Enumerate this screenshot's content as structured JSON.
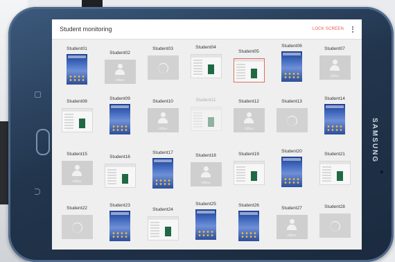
{
  "header": {
    "title": "Student monitoring",
    "lock_label": "LOCK SCREEN"
  },
  "device": {
    "brand": "SAMSUNG"
  },
  "offline_label": "Offline",
  "students": [
    {
      "name": "Student01",
      "state": "home"
    },
    {
      "name": "Student02",
      "state": "offline"
    },
    {
      "name": "Student03",
      "state": "loading"
    },
    {
      "name": "Student04",
      "state": "app"
    },
    {
      "name": "Student05",
      "state": "app-active"
    },
    {
      "name": "Student06",
      "state": "home"
    },
    {
      "name": "Student07",
      "state": "offline"
    },
    {
      "name": "Student08",
      "state": "app"
    },
    {
      "name": "Student09",
      "state": "home"
    },
    {
      "name": "Student10",
      "state": "offline"
    },
    {
      "name": "Student11",
      "state": "app-faded"
    },
    {
      "name": "Student12",
      "state": "offline"
    },
    {
      "name": "Student13",
      "state": "loading"
    },
    {
      "name": "Student14",
      "state": "home"
    },
    {
      "name": "Student15",
      "state": "offline"
    },
    {
      "name": "Student16",
      "state": "app"
    },
    {
      "name": "Student17",
      "state": "home"
    },
    {
      "name": "Student18",
      "state": "offline"
    },
    {
      "name": "Student19",
      "state": "app"
    },
    {
      "name": "Student20",
      "state": "home"
    },
    {
      "name": "Student21",
      "state": "app"
    },
    {
      "name": "Student22",
      "state": "loading"
    },
    {
      "name": "Student23",
      "state": "home"
    },
    {
      "name": "Student24",
      "state": "app"
    },
    {
      "name": "Student25",
      "state": "home"
    },
    {
      "name": "Student26",
      "state": "home"
    },
    {
      "name": "Student27",
      "state": "offline"
    },
    {
      "name": "Student28",
      "state": "loading"
    }
  ],
  "colors": {
    "accent": "#e0594f",
    "bezel": "#22354d"
  }
}
